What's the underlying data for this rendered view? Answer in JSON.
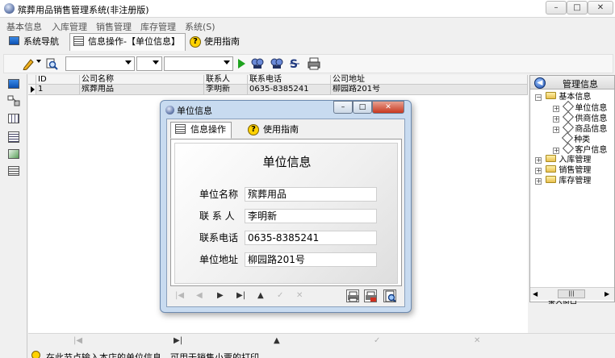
{
  "window": {
    "title": "殡葬用品销售管理系统(非注册版)",
    "minimize": "–",
    "maximize": "□",
    "close": "✕"
  },
  "menu": [
    "基本信息",
    "入库管理",
    "销售管理",
    "库存管理",
    "系统(S)"
  ],
  "tabs": [
    {
      "label": "系统导航",
      "icon": "monitor-icon"
    },
    {
      "label": "信息操作-【单位信息】",
      "icon": "grid-icon"
    },
    {
      "label": "使用指南",
      "icon": "question-icon"
    }
  ],
  "grid": {
    "columns": [
      "ID",
      "公司名称",
      "联系人",
      "联系电话",
      "公司地址"
    ],
    "rows": [
      {
        "id": "1",
        "company": "殡葬用品",
        "contact": "李明新",
        "phone": "0635-8385241",
        "address": "柳园路201号"
      }
    ]
  },
  "right_panel": {
    "title": "管理信息",
    "tree": {
      "root": "基本信息",
      "children": [
        "单位信息",
        "供商信息",
        "商品信息",
        "种类",
        "客户信息"
      ],
      "others": [
        "入库管理",
        "销售管理",
        "库存管理"
      ]
    },
    "scroll_left": "◀",
    "scroll_thumb": "|||",
    "scroll_right": "▶",
    "bottom_text": "录入窗口"
  },
  "bottom_nav": [
    "|◀",
    "▶|",
    "▲",
    "✓",
    "✕"
  ],
  "status": "在此节点输入本店的单位信息，可用于销售小票的打印",
  "dialog": {
    "title": "单位信息",
    "tabs": [
      {
        "label": "信息操作",
        "icon": "grid-icon"
      },
      {
        "label": "使用指南",
        "icon": "question-icon"
      }
    ],
    "heading": "单位信息",
    "fields": [
      {
        "label": "单位名称",
        "value": "殡葬用品"
      },
      {
        "label": "联 系 人",
        "value": "李明新"
      },
      {
        "label": "联系电话",
        "value": "0635-8385241"
      },
      {
        "label": "单位地址",
        "value": "柳园路201号"
      }
    ],
    "nav": [
      "|◀",
      "◀",
      "▶",
      "▶|",
      "▲",
      "✓",
      "✕"
    ]
  },
  "colors": {
    "dialog_frame": "#c8dbf0",
    "row_highlight": "#e6e6e6",
    "play_green": "#1fa31f"
  }
}
